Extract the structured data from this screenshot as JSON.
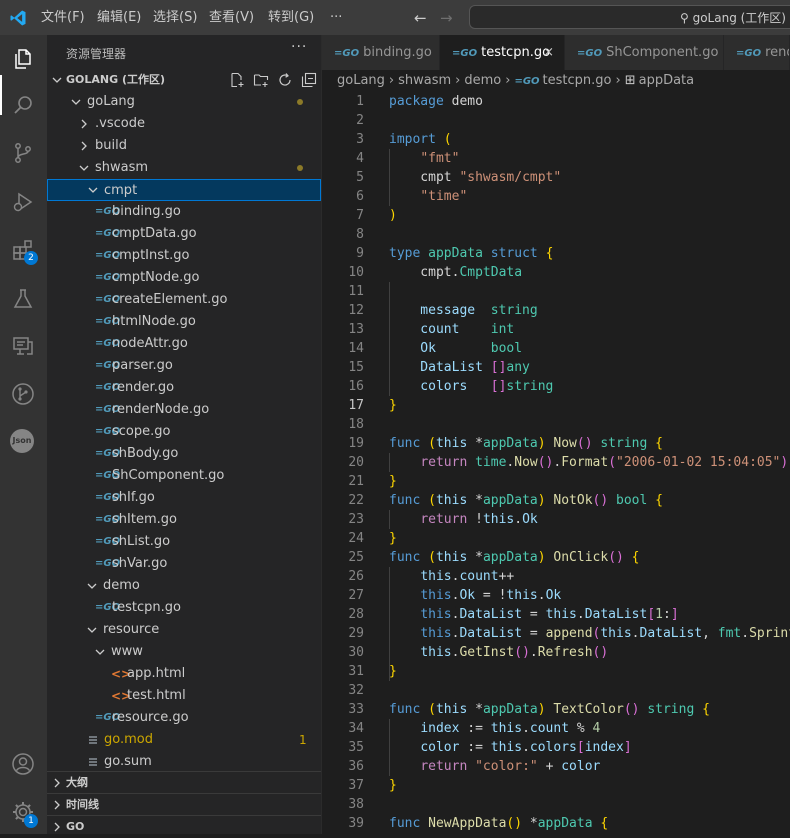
{
  "titlebar": {
    "menus": [
      "文件(F)",
      "编辑(E)",
      "选择(S)",
      "查看(V)",
      "转到(G)",
      "···"
    ],
    "search_text": "goLang (工作区)"
  },
  "activity_bar": {
    "items": [
      {
        "name": "explorer-icon"
      },
      {
        "name": "search-icon"
      },
      {
        "name": "source-control-icon"
      },
      {
        "name": "run-debug-icon"
      },
      {
        "name": "extensions-icon",
        "badge": "2"
      },
      {
        "name": "testing-icon"
      },
      {
        "name": "remote-explorer-icon"
      },
      {
        "name": "git-graph-icon"
      },
      {
        "name": "json-icon",
        "text": "Json"
      }
    ],
    "bottom": [
      {
        "name": "account-icon"
      },
      {
        "name": "settings-gear-icon",
        "badge": "1"
      }
    ]
  },
  "sidebar": {
    "title": "资源管理器",
    "more": "···",
    "workspace": "GOLANG (工作区)",
    "tree": [
      {
        "label": "goLang",
        "depth": 0,
        "type": "folder",
        "open": true,
        "dot": true,
        "color": "#cccccc"
      },
      {
        "label": ".vscode",
        "depth": 1,
        "type": "folder",
        "open": false
      },
      {
        "label": "build",
        "depth": 1,
        "type": "folder",
        "open": false
      },
      {
        "label": "shwasm",
        "depth": 1,
        "type": "folder",
        "open": true,
        "dot": true
      },
      {
        "label": "cmpt",
        "depth": 2,
        "type": "folder",
        "open": true,
        "selected": true
      },
      {
        "label": "binding.go",
        "depth": 3,
        "type": "go"
      },
      {
        "label": "cmptData.go",
        "depth": 3,
        "type": "go"
      },
      {
        "label": "cmptInst.go",
        "depth": 3,
        "type": "go"
      },
      {
        "label": "cmptNode.go",
        "depth": 3,
        "type": "go"
      },
      {
        "label": "createElement.go",
        "depth": 3,
        "type": "go"
      },
      {
        "label": "htmlNode.go",
        "depth": 3,
        "type": "go"
      },
      {
        "label": "nodeAttr.go",
        "depth": 3,
        "type": "go"
      },
      {
        "label": "parser.go",
        "depth": 3,
        "type": "go"
      },
      {
        "label": "render.go",
        "depth": 3,
        "type": "go"
      },
      {
        "label": "renderNode.go",
        "depth": 3,
        "type": "go"
      },
      {
        "label": "scope.go",
        "depth": 3,
        "type": "go"
      },
      {
        "label": "shBody.go",
        "depth": 3,
        "type": "go"
      },
      {
        "label": "ShComponent.go",
        "depth": 3,
        "type": "go"
      },
      {
        "label": "shIf.go",
        "depth": 3,
        "type": "go"
      },
      {
        "label": "shItem.go",
        "depth": 3,
        "type": "go"
      },
      {
        "label": "shList.go",
        "depth": 3,
        "type": "go"
      },
      {
        "label": "shVar.go",
        "depth": 3,
        "type": "go"
      },
      {
        "label": "demo",
        "depth": 2,
        "type": "folder",
        "open": true
      },
      {
        "label": "testcpn.go",
        "depth": 3,
        "type": "go"
      },
      {
        "label": "resource",
        "depth": 2,
        "type": "folder",
        "open": true
      },
      {
        "label": "www",
        "depth": 3,
        "type": "folder",
        "open": true
      },
      {
        "label": "app.html",
        "depth": 4,
        "type": "html"
      },
      {
        "label": "test.html",
        "depth": 4,
        "type": "html"
      },
      {
        "label": "resource.go",
        "depth": 3,
        "type": "go"
      },
      {
        "label": "go.mod",
        "depth": 2,
        "type": "mod",
        "count": "1",
        "color": "#cca700"
      },
      {
        "label": "go.sum",
        "depth": 2,
        "type": "mod"
      }
    ],
    "sections": [
      "大纲",
      "时间线",
      "GO"
    ]
  },
  "tabs": [
    {
      "label": "binding.go",
      "active": false
    },
    {
      "label": "testcpn.go",
      "active": true,
      "close": "×"
    },
    {
      "label": "ShComponent.go",
      "active": false
    },
    {
      "label": "rende",
      "active": false
    }
  ],
  "breadcrumb": [
    "goLang",
    "shwasm",
    "demo",
    "testcpn.go",
    "appData"
  ],
  "editor": {
    "current_line": 17,
    "lines": [
      [
        [
          "package ",
          "kw"
        ],
        [
          "demo",
          "plain"
        ]
      ],
      [],
      [
        [
          "import ",
          "kw"
        ],
        [
          "(",
          "br1"
        ]
      ],
      [
        [
          "    ",
          "plain"
        ],
        [
          "\"fmt\"",
          "str"
        ]
      ],
      [
        [
          "    cmpt ",
          "plain"
        ],
        [
          "\"shwasm/cmpt\"",
          "str"
        ]
      ],
      [
        [
          "    ",
          "plain"
        ],
        [
          "\"time\"",
          "str"
        ]
      ],
      [
        [
          ")",
          "br1"
        ]
      ],
      [],
      [
        [
          "type ",
          "kw"
        ],
        [
          "appData ",
          "ty"
        ],
        [
          "struct ",
          "kw"
        ],
        [
          "{",
          "br1"
        ]
      ],
      [
        [
          "    cmpt.",
          "plain"
        ],
        [
          "CmptData",
          "ty"
        ]
      ],
      [],
      [
        [
          "    message  ",
          "var"
        ],
        [
          "string",
          "ty"
        ]
      ],
      [
        [
          "    count    ",
          "var"
        ],
        [
          "int",
          "ty"
        ]
      ],
      [
        [
          "    Ok       ",
          "var"
        ],
        [
          "bool",
          "ty"
        ]
      ],
      [
        [
          "    DataList ",
          "var"
        ],
        [
          "[]",
          "br2"
        ],
        [
          "any",
          "ty"
        ]
      ],
      [
        [
          "    colors   ",
          "var"
        ],
        [
          "[]",
          "br2"
        ],
        [
          "string",
          "ty"
        ]
      ],
      [
        [
          "}",
          "br1"
        ]
      ],
      [],
      [
        [
          "func ",
          "kw"
        ],
        [
          "(",
          "br1"
        ],
        [
          "this ",
          "var"
        ],
        [
          "*",
          "plain"
        ],
        [
          "appData",
          "ty"
        ],
        [
          ") ",
          "br1"
        ],
        [
          "Now",
          "fn"
        ],
        [
          "()",
          "br2"
        ],
        [
          " ",
          "plain"
        ],
        [
          "string ",
          "ty"
        ],
        [
          "{",
          "br1"
        ]
      ],
      [
        [
          "    ",
          "plain"
        ],
        [
          "return ",
          "ctl"
        ],
        [
          "time",
          "ty"
        ],
        [
          ".",
          "plain"
        ],
        [
          "Now",
          "fn"
        ],
        [
          "()",
          "br2"
        ],
        [
          ".",
          "plain"
        ],
        [
          "Format",
          "fn"
        ],
        [
          "(",
          "br2"
        ],
        [
          "\"2006-01-02 15:04:05\"",
          "str"
        ],
        [
          ")",
          "br2"
        ]
      ],
      [
        [
          "}",
          "br1"
        ]
      ],
      [
        [
          "func ",
          "kw"
        ],
        [
          "(",
          "br1"
        ],
        [
          "this ",
          "var"
        ],
        [
          "*",
          "plain"
        ],
        [
          "appData",
          "ty"
        ],
        [
          ") ",
          "br1"
        ],
        [
          "NotOk",
          "fn"
        ],
        [
          "()",
          "br2"
        ],
        [
          " ",
          "plain"
        ],
        [
          "bool ",
          "ty"
        ],
        [
          "{",
          "br1"
        ]
      ],
      [
        [
          "    ",
          "plain"
        ],
        [
          "return ",
          "ctl"
        ],
        [
          "!",
          "plain"
        ],
        [
          "this",
          "var"
        ],
        [
          ".",
          "plain"
        ],
        [
          "Ok",
          "var"
        ]
      ],
      [
        [
          "}",
          "br1"
        ]
      ],
      [
        [
          "func ",
          "kw"
        ],
        [
          "(",
          "br1"
        ],
        [
          "this ",
          "var"
        ],
        [
          "*",
          "plain"
        ],
        [
          "appData",
          "ty"
        ],
        [
          ") ",
          "br1"
        ],
        [
          "OnClick",
          "fn"
        ],
        [
          "()",
          "br2"
        ],
        [
          " ",
          "plain"
        ],
        [
          "{",
          "br1"
        ]
      ],
      [
        [
          "    ",
          "plain"
        ],
        [
          "this",
          "var"
        ],
        [
          ".",
          "plain"
        ],
        [
          "count",
          "var"
        ],
        [
          "++",
          "plain"
        ]
      ],
      [
        [
          "    ",
          "plain"
        ],
        [
          "this",
          "kw"
        ],
        [
          ".",
          "plain"
        ],
        [
          "Ok",
          "var"
        ],
        [
          " = !",
          "plain"
        ],
        [
          "this",
          "var"
        ],
        [
          ".",
          "plain"
        ],
        [
          "Ok",
          "var"
        ]
      ],
      [
        [
          "    ",
          "plain"
        ],
        [
          "this",
          "kw"
        ],
        [
          ".",
          "plain"
        ],
        [
          "DataList",
          "var"
        ],
        [
          " = ",
          "plain"
        ],
        [
          "this",
          "var"
        ],
        [
          ".",
          "plain"
        ],
        [
          "DataList",
          "var"
        ],
        [
          "[",
          "br2"
        ],
        [
          "1",
          "num"
        ],
        [
          ":",
          "plain"
        ],
        [
          "]",
          "br2"
        ]
      ],
      [
        [
          "    ",
          "plain"
        ],
        [
          "this",
          "kw"
        ],
        [
          ".",
          "plain"
        ],
        [
          "DataList",
          "var"
        ],
        [
          " = ",
          "plain"
        ],
        [
          "append",
          "fn"
        ],
        [
          "(",
          "br2"
        ],
        [
          "this",
          "var"
        ],
        [
          ".",
          "plain"
        ],
        [
          "DataList",
          "var"
        ],
        [
          ", ",
          "plain"
        ],
        [
          "fmt",
          "ty"
        ],
        [
          ".",
          "plain"
        ],
        [
          "Sprint",
          "fn"
        ]
      ],
      [
        [
          "    ",
          "plain"
        ],
        [
          "this",
          "var"
        ],
        [
          ".",
          "plain"
        ],
        [
          "GetInst",
          "fn"
        ],
        [
          "()",
          "br2"
        ],
        [
          ".",
          "plain"
        ],
        [
          "Refresh",
          "fn"
        ],
        [
          "()",
          "br2"
        ]
      ],
      [
        [
          "}",
          "br1"
        ]
      ],
      [],
      [
        [
          "func ",
          "kw"
        ],
        [
          "(",
          "br1"
        ],
        [
          "this ",
          "var"
        ],
        [
          "*",
          "plain"
        ],
        [
          "appData",
          "ty"
        ],
        [
          ") ",
          "br1"
        ],
        [
          "TextColor",
          "fn"
        ],
        [
          "()",
          "br2"
        ],
        [
          " ",
          "plain"
        ],
        [
          "string ",
          "ty"
        ],
        [
          "{",
          "br1"
        ]
      ],
      [
        [
          "    ",
          "plain"
        ],
        [
          "index ",
          "var"
        ],
        [
          ":= ",
          "plain"
        ],
        [
          "this",
          "var"
        ],
        [
          ".",
          "plain"
        ],
        [
          "count ",
          "var"
        ],
        [
          "% ",
          "plain"
        ],
        [
          "4",
          "num"
        ]
      ],
      [
        [
          "    ",
          "plain"
        ],
        [
          "color ",
          "var"
        ],
        [
          ":= ",
          "plain"
        ],
        [
          "this",
          "var"
        ],
        [
          ".",
          "plain"
        ],
        [
          "colors",
          "var"
        ],
        [
          "[",
          "br2"
        ],
        [
          "index",
          "var"
        ],
        [
          "]",
          "br2"
        ]
      ],
      [
        [
          "    ",
          "plain"
        ],
        [
          "return ",
          "ctl"
        ],
        [
          "\"color:\" ",
          "str"
        ],
        [
          "+ ",
          "plain"
        ],
        [
          "color",
          "var"
        ]
      ],
      [
        [
          "}",
          "br1"
        ]
      ],
      [],
      [
        [
          "func ",
          "kw"
        ],
        [
          "NewAppData",
          "fn"
        ],
        [
          "() ",
          "br1"
        ],
        [
          "*",
          "plain"
        ],
        [
          "appData ",
          "ty"
        ],
        [
          "{",
          "br1"
        ]
      ]
    ]
  }
}
